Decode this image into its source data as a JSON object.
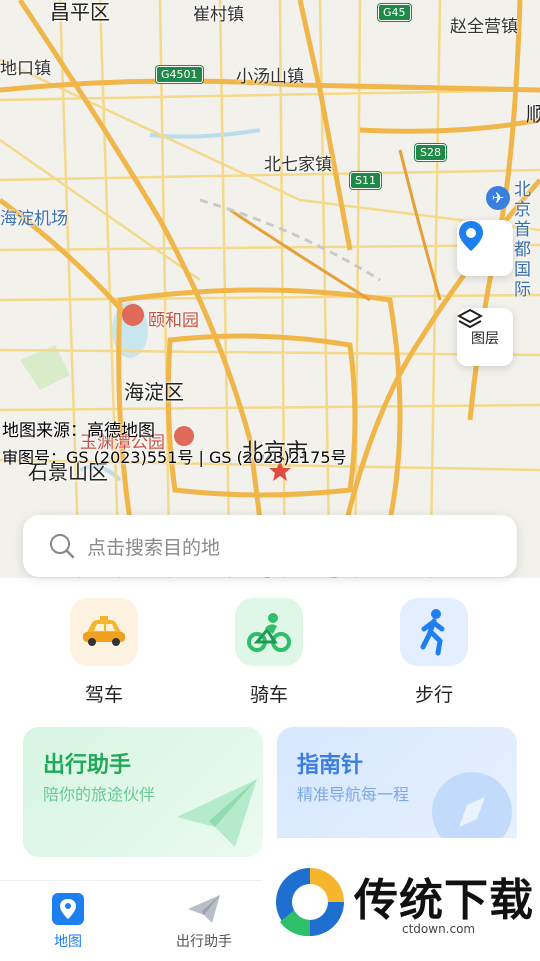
{
  "map": {
    "places": {
      "changping": "昌平区",
      "cuicun": "崔村镇",
      "beijing_ring": "赵全营镇",
      "hekou": "地口镇",
      "xiaotangshan": "小汤山镇",
      "beiqijia": "北七家镇",
      "shun": "顺",
      "airport": "北京首都国际",
      "haidian_airport": "海淀机场",
      "summer_palace": "颐和园",
      "haidian": "海淀区",
      "yuyuantan": "玉渊潭公园",
      "beijing_city": "北京市",
      "shijingshan": "石景山区"
    },
    "shields": {
      "g45": "G45",
      "g4501": "G4501",
      "s28": "S28",
      "s11": "S11"
    },
    "credit_line1": "地图来源：高德地图",
    "credit_line2": "审图号：GS (2023)551号 | GS (2023)2175号",
    "layers_label": "图层"
  },
  "search": {
    "placeholder": "点击搜索目的地"
  },
  "modes": [
    {
      "label": "驾车",
      "icon": "taxi-icon"
    },
    {
      "label": "骑车",
      "icon": "cyclist-icon"
    },
    {
      "label": "步行",
      "icon": "walking-person-icon"
    }
  ],
  "cards": {
    "assistant": {
      "title": "出行助手",
      "subtitle": "陪你的旅途伙伴"
    },
    "compass": {
      "title": "指南针",
      "subtitle": "精准导航每一程"
    }
  },
  "tabs": [
    {
      "label": "地图",
      "active": true
    },
    {
      "label": "出行助手",
      "active": false
    }
  ],
  "watermark": {
    "brand": "传统下载",
    "domain": "ctdown.com"
  },
  "colors": {
    "accent": "#1e7ff0",
    "green": "#2fbf6b",
    "blue_title": "#3a7fe0"
  }
}
